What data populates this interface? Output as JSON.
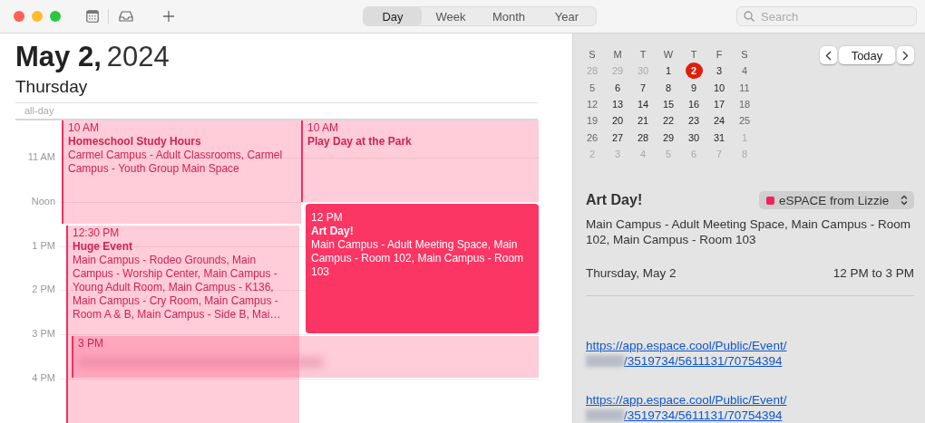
{
  "toolbar": {
    "views": [
      {
        "label": "Day",
        "selected": true
      },
      {
        "label": "Week",
        "selected": false
      },
      {
        "label": "Month",
        "selected": false
      },
      {
        "label": "Year",
        "selected": false
      }
    ],
    "search": {
      "placeholder": "Search"
    }
  },
  "header": {
    "date": "May 2,",
    "year": "2024",
    "weekday": "Thursday",
    "all_day_label": "all-day"
  },
  "time_labels": [
    "11 AM",
    "Noon",
    "1 PM",
    "2 PM",
    "3 PM",
    "4 PM"
  ],
  "events": [
    {
      "time": "10 AM",
      "title": "Homeschool Study Hours",
      "location": "Carmel Campus - Adult Classrooms, Carmel Campus - Youth Group Main Space",
      "selected": false
    },
    {
      "time": "10 AM",
      "title": "Play Day at the Park",
      "selected": false
    },
    {
      "time": "12 PM",
      "title": "Art Day!",
      "location": "Main Campus - Adult Meeting Space, Main Campus - Room 102, Main Campus - Room 103",
      "selected": true
    },
    {
      "time": "12:30 PM",
      "title": "Huge Event",
      "location": "Main Campus - Rodeo Grounds, Main Campus - Worship Center, Main Campus - Young Adult Room, Main Campus - K136, Main Campus - Cry Room, Main Campus - Room A & B, Main Campus - Side B, Mai…",
      "selected": false
    },
    {
      "time": "3 PM",
      "selected": false
    }
  ],
  "mini_calendar": {
    "weekdays": [
      "S",
      "M",
      "T",
      "W",
      "T",
      "F",
      "S"
    ],
    "weeks": [
      [
        {
          "day": "28",
          "in_month": false,
          "selected": false
        },
        {
          "day": "29",
          "in_month": false,
          "selected": false
        },
        {
          "day": "30",
          "in_month": false,
          "selected": false
        },
        {
          "day": "1",
          "in_month": true,
          "selected": false
        },
        {
          "day": "2",
          "in_month": true,
          "selected": true
        },
        {
          "day": "3",
          "in_month": true,
          "selected": false
        },
        {
          "day": "4",
          "in_month": true,
          "selected": false
        }
      ],
      [
        {
          "day": "5",
          "in_month": true,
          "selected": false
        },
        {
          "day": "6",
          "in_month": true,
          "selected": false
        },
        {
          "day": "7",
          "in_month": true,
          "selected": false
        },
        {
          "day": "8",
          "in_month": true,
          "selected": false
        },
        {
          "day": "9",
          "in_month": true,
          "selected": false
        },
        {
          "day": "10",
          "in_month": true,
          "selected": false
        },
        {
          "day": "11",
          "in_month": true,
          "selected": false
        }
      ],
      [
        {
          "day": "12",
          "in_month": true,
          "selected": false
        },
        {
          "day": "13",
          "in_month": true,
          "selected": false
        },
        {
          "day": "14",
          "in_month": true,
          "selected": false
        },
        {
          "day": "15",
          "in_month": true,
          "selected": false
        },
        {
          "day": "16",
          "in_month": true,
          "selected": false
        },
        {
          "day": "17",
          "in_month": true,
          "selected": false
        },
        {
          "day": "18",
          "in_month": true,
          "selected": false
        }
      ],
      [
        {
          "day": "19",
          "in_month": true,
          "selected": false
        },
        {
          "day": "20",
          "in_month": true,
          "selected": false
        },
        {
          "day": "21",
          "in_month": true,
          "selected": false
        },
        {
          "day": "22",
          "in_month": true,
          "selected": false
        },
        {
          "day": "23",
          "in_month": true,
          "selected": false
        },
        {
          "day": "24",
          "in_month": true,
          "selected": false
        },
        {
          "day": "25",
          "in_month": true,
          "selected": false
        }
      ],
      [
        {
          "day": "26",
          "in_month": true,
          "selected": false
        },
        {
          "day": "27",
          "in_month": true,
          "selected": false
        },
        {
          "day": "28",
          "in_month": true,
          "selected": false
        },
        {
          "day": "29",
          "in_month": true,
          "selected": false
        },
        {
          "day": "30",
          "in_month": true,
          "selected": false
        },
        {
          "day": "31",
          "in_month": true,
          "selected": false
        },
        {
          "day": "1",
          "in_month": false,
          "selected": false
        }
      ],
      [
        {
          "day": "2",
          "in_month": false,
          "selected": false
        },
        {
          "day": "3",
          "in_month": false,
          "selected": false
        },
        {
          "day": "4",
          "in_month": false,
          "selected": false
        },
        {
          "day": "5",
          "in_month": false,
          "selected": false
        },
        {
          "day": "6",
          "in_month": false,
          "selected": false
        },
        {
          "day": "7",
          "in_month": false,
          "selected": false
        },
        {
          "day": "8",
          "in_month": false,
          "selected": false
        }
      ]
    ],
    "today_button": "Today"
  },
  "detail": {
    "title": "Art Day!",
    "calendar": {
      "name": "eSPACE from Lizzie",
      "color": "#f0245a"
    },
    "location": "Main Campus - Adult Meeting Space, Main Campus - Room 102, Main Campus - Room 103",
    "date": "Thursday, May 2",
    "time_range": "12 PM to 3 PM",
    "links": [
      {
        "first_line": "https://app.espace.cool/Public/Event/",
        "second_line": "/3519734/5611131/70754394"
      },
      {
        "first_line": "https://app.espace.cool/Public/Event/",
        "second_line": "/3519734/5611131/70754394"
      }
    ]
  }
}
